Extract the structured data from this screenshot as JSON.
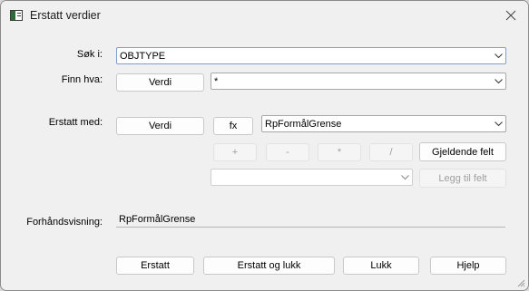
{
  "window": {
    "title": "Erstatt verdier",
    "close_icon": "close-icon"
  },
  "search_in": {
    "label": "Søk i:",
    "value": "OBJTYPE"
  },
  "find_what": {
    "label": "Finn hva:",
    "button": "Verdi",
    "value": "*"
  },
  "replace_with": {
    "label": "Erstatt med:",
    "button": "Verdi",
    "fx_button": "fx",
    "value": "RpFormålGrense",
    "operators": [
      "+",
      "-",
      "*",
      "/"
    ],
    "current_field_button": "Gjeldende felt",
    "field_value": "",
    "add_field_button": "Legg til felt"
  },
  "preview": {
    "label": "Forhåndsvisning:",
    "value": "RpFormålGrense"
  },
  "footer": {
    "replace": "Erstatt",
    "replace_close": "Erstatt og lukk",
    "close": "Lukk",
    "help": "Hjelp"
  }
}
